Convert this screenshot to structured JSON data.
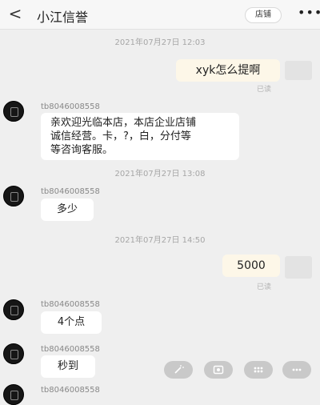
{
  "header": {
    "back_icon": "chevron-left-icon",
    "back_glyph": "<",
    "title": "小江信誉",
    "shop_button": "店铺",
    "more_glyph": "•••"
  },
  "messages": [
    {
      "type": "timestamp",
      "text": "2021年07月27日 12:03"
    },
    {
      "type": "outgoing",
      "text": "xyk怎么提啊",
      "status": "已读"
    },
    {
      "type": "incoming",
      "sender": "tb8046008558",
      "lines": [
        "亲欢迎光临本店，本店企业店铺",
        "诚信经营。卡，?，白，分付等",
        "等咨询客服。"
      ]
    },
    {
      "type": "timestamp",
      "text": "2021年07月27日 13:08"
    },
    {
      "type": "incoming",
      "sender": "tb8046008558",
      "text": "多少"
    },
    {
      "type": "timestamp",
      "text": "2021年07月27日 14:50"
    },
    {
      "type": "outgoing",
      "text": "5000",
      "status": "已读"
    },
    {
      "type": "incoming",
      "sender": "tb8046008558",
      "text": "4个点"
    },
    {
      "type": "incoming",
      "sender": "tb8046008558",
      "text": "秒到"
    },
    {
      "type": "incoming",
      "sender": "tb8046008558",
      "text": ""
    }
  ],
  "tool_icons": [
    "magic-wand-icon",
    "photo-icon",
    "menu-grid-icon",
    "more-icon"
  ],
  "colors": {
    "background": "#efefef",
    "outgoing_bubble": "#fdf7e8",
    "incoming_bubble": "#ffffff",
    "tool_button": "#c9c9c9"
  }
}
